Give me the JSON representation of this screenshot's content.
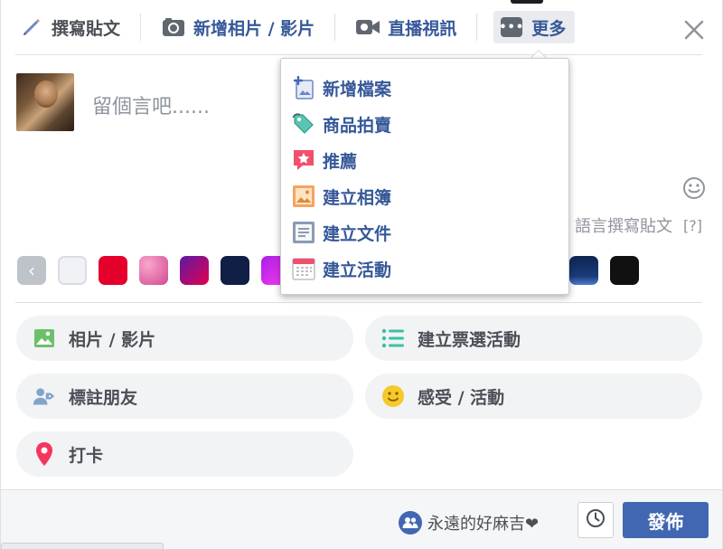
{
  "tabs": [
    {
      "label": "撰寫貼文",
      "icon": "pencil-icon"
    },
    {
      "label": "新增相片 / 影片",
      "icon": "camera-icon"
    },
    {
      "label": "直播視訊",
      "icon": "video-camera-icon"
    },
    {
      "label": "更多",
      "icon": "more-dots-icon"
    }
  ],
  "composer": {
    "placeholder": "留個言吧......",
    "write_other_language": "語言撰寫貼文",
    "help": "[?]"
  },
  "swatches": {
    "left": [
      "#e2e4e8",
      "#e4002b",
      "#e26ea8",
      "#8c1b7f",
      "#0f1f45",
      "#c12cf0"
    ],
    "right": [
      "#1f3c6a",
      "#0e2451",
      "#111111"
    ]
  },
  "menu": {
    "items": [
      {
        "label": "新增檔案",
        "icon": "add-file-icon"
      },
      {
        "label": "商品拍賣",
        "icon": "price-tag-icon"
      },
      {
        "label": "推薦",
        "icon": "star-recommend-icon"
      },
      {
        "label": "建立相簿",
        "icon": "photo-album-icon"
      },
      {
        "label": "建立文件",
        "icon": "document-icon"
      },
      {
        "label": "建立活動",
        "icon": "calendar-event-icon"
      }
    ]
  },
  "actions": [
    {
      "label": "相片 / 影片",
      "icon": "photo-icon"
    },
    {
      "label": "建立票選活動",
      "icon": "poll-list-icon"
    },
    {
      "label": "標註朋友",
      "icon": "tag-friend-icon"
    },
    {
      "label": "感受 / 活動",
      "icon": "smiley-icon"
    },
    {
      "label": "打卡",
      "icon": "location-pin-icon"
    }
  ],
  "footer": {
    "audience": "永遠的好麻吉❤",
    "post_label": "發佈"
  },
  "colors": {
    "link_blue": "#365899",
    "button_blue": "#4267b2"
  }
}
